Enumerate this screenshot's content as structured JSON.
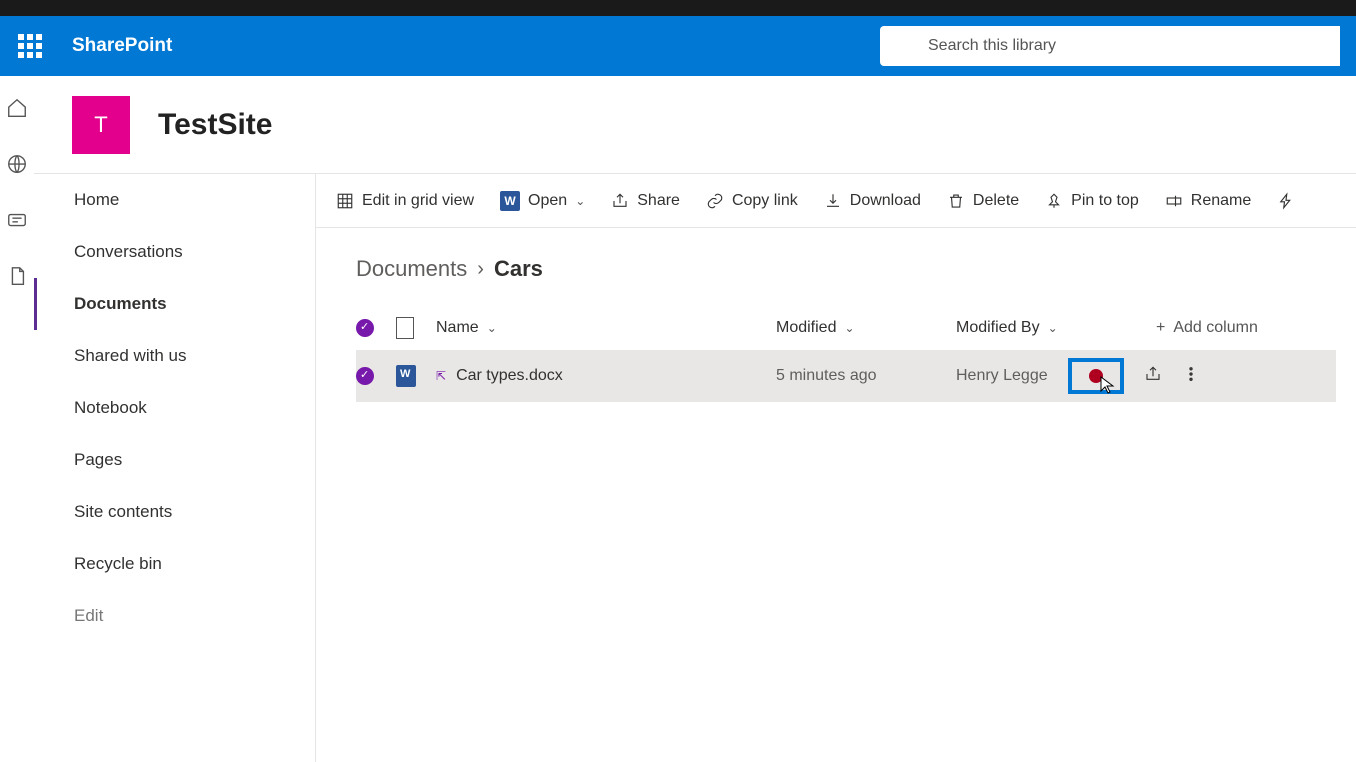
{
  "header": {
    "brand": "SharePoint",
    "search_placeholder": "Search this library"
  },
  "site": {
    "logo_letter": "T",
    "title": "TestSite"
  },
  "nav": {
    "items": [
      "Home",
      "Conversations",
      "Documents",
      "Shared with us",
      "Notebook",
      "Pages",
      "Site contents",
      "Recycle bin"
    ],
    "active_index": 2,
    "edit_label": "Edit"
  },
  "toolbar": {
    "edit_grid": "Edit in grid view",
    "open": "Open",
    "share": "Share",
    "copy_link": "Copy link",
    "download": "Download",
    "delete": "Delete",
    "pin": "Pin to top",
    "rename": "Rename"
  },
  "breadcrumb": {
    "parent": "Documents",
    "current": "Cars"
  },
  "columns": {
    "name": "Name",
    "modified": "Modified",
    "modified_by": "Modified By",
    "add": "Add column"
  },
  "rows": [
    {
      "name": "Car types.docx",
      "modified": "5 minutes ago",
      "modified_by": "Henry Legge"
    }
  ]
}
